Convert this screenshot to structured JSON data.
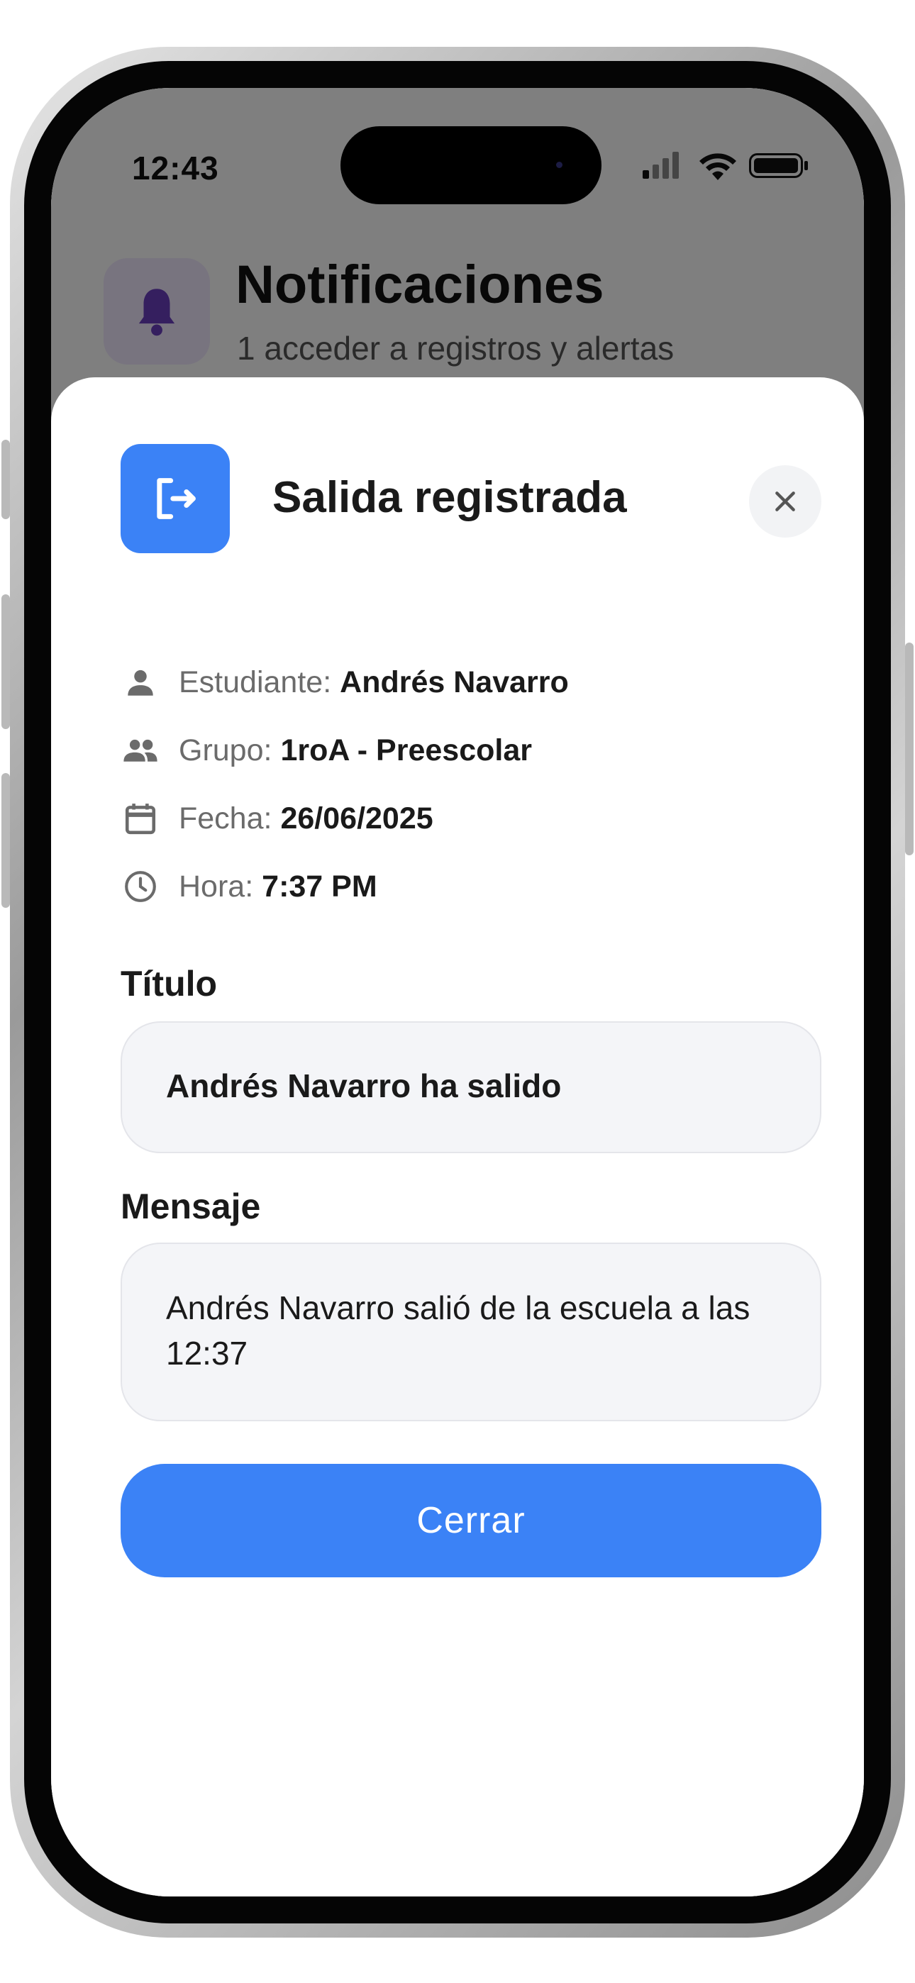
{
  "status_bar": {
    "time": "12:43",
    "icons": [
      "signal-icon",
      "wifi-icon",
      "battery-icon"
    ]
  },
  "background": {
    "title": "Notificaciones",
    "subtitle": "1 acceder a registros y alertas",
    "icon": "bell-icon",
    "accent": "#6b3fbf"
  },
  "dialog": {
    "title": "Salida registrada",
    "icon": "exit-icon",
    "accent": "#3b82f6",
    "info": [
      {
        "icon": "person-icon",
        "label": "Estudiante:",
        "value": "Andrés Navarro"
      },
      {
        "icon": "group-icon",
        "label": "Grupo:",
        "value": "1roA - Preescolar"
      },
      {
        "icon": "calendar-icon",
        "label": "Fecha:",
        "value": "26/06/2025"
      },
      {
        "icon": "clock-icon",
        "label": "Hora:",
        "value": "7:37 PM"
      }
    ],
    "title_field": {
      "label": "Título",
      "value": "Andrés Navarro ha salido"
    },
    "message_field": {
      "label": "Mensaje",
      "value": "Andrés Navarro salió de la escuela a las 12:37"
    },
    "close_button_label": "Cerrar"
  }
}
